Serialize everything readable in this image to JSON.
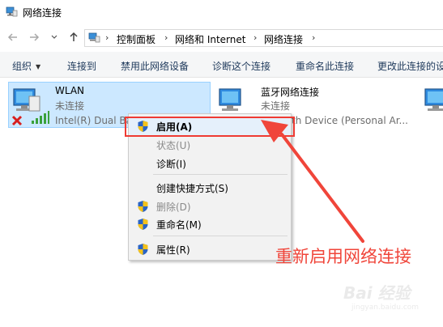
{
  "window": {
    "title": "网络连接"
  },
  "nav": {
    "back_icon": "arrow-left-icon",
    "forward_icon": "arrow-right-icon",
    "recent_icon": "chevron-down-icon",
    "up_icon": "arrow-up-icon",
    "breadcrumb": [
      "控制面板",
      "网络和 Internet",
      "网络连接"
    ],
    "separator": "›"
  },
  "commands": {
    "organize": "组织",
    "connect_to": "连接到",
    "disable_device": "禁用此网络设备",
    "diagnose": "诊断这个连接",
    "rename": "重命名此连接",
    "change_settings": "更改此连接的设置"
  },
  "connections": [
    {
      "name": "WLAN",
      "status": "未连接",
      "device": "Intel(R) Dual Ba",
      "selected": true
    },
    {
      "name": "蓝牙网络连接",
      "status": "未连接",
      "device": "th Device (Personal Ar..."
    }
  ],
  "context_menu": {
    "items": [
      {
        "label": "启用(A)",
        "shield": true,
        "disabled": false,
        "bold": true
      },
      {
        "label": "状态(U)",
        "shield": false,
        "disabled": true
      },
      {
        "label": "诊断(I)",
        "shield": false,
        "disabled": false
      },
      {
        "label": "创建快捷方式(S)",
        "shield": false,
        "disabled": false
      },
      {
        "label": "删除(D)",
        "shield": true,
        "disabled": true
      },
      {
        "label": "重命名(M)",
        "shield": true,
        "disabled": false
      },
      {
        "label": "属性(R)",
        "shield": true,
        "disabled": false
      }
    ]
  },
  "annotation": {
    "text": "重新启用网络连接",
    "color": "#f0453a"
  },
  "watermark": {
    "text": "Bai 经验",
    "sub": "jingyan.baidu.com"
  },
  "colors": {
    "selection": "#cce8ff",
    "highlight_box": "#ef3b33",
    "menu_bg": "#f2f2f2"
  }
}
